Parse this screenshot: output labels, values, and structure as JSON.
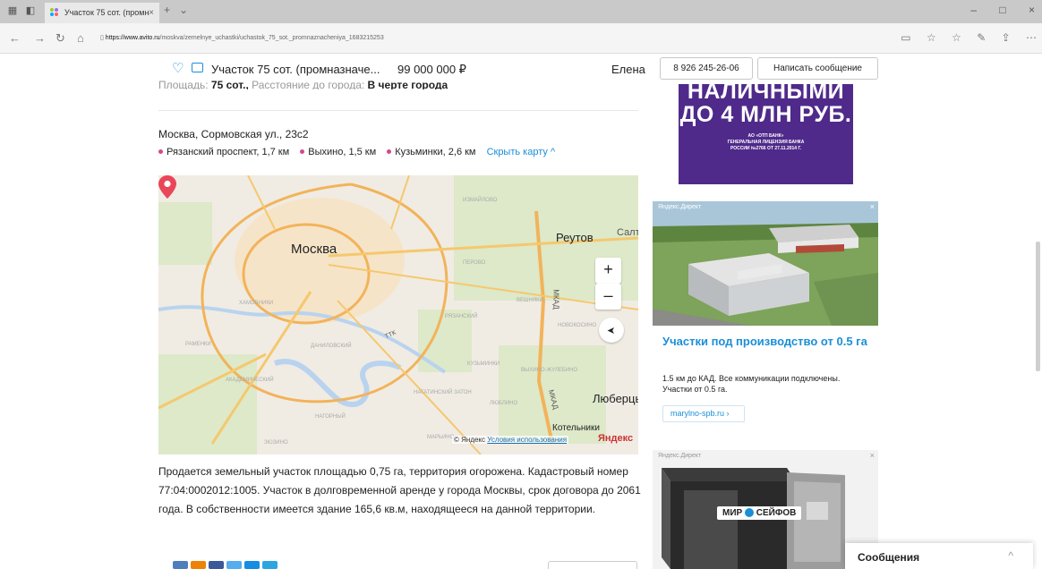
{
  "browser": {
    "tab_title": "Участок 75 сот. (промн",
    "tab_close": "×",
    "new_tab": "+",
    "tab_dropdown": "⌄",
    "window_controls": [
      "–",
      "□",
      "×"
    ],
    "url_host": "https://www.avito.ru",
    "url_path": "/moskva/zemelnye_uchastki/uchastok_75_sot._promnaznacheniya_1683215253"
  },
  "sticky": {
    "title": "Участок 75 сот. (промназначе...",
    "price": "99 000 000 ₽",
    "seller": "Елена",
    "phone": "8 926 245-26-06",
    "message_button": "Написать сообщение"
  },
  "details": {
    "area_label": "Площадь:",
    "area_value": "75 сот.,",
    "distance_label": "Расстояние до города:",
    "distance_value": "В черте города"
  },
  "location": {
    "address": "Москва, Сормовская ул., 23с2",
    "metro": [
      {
        "name": "Рязанский проспект, 1,7 км",
        "color": "#d44a88"
      },
      {
        "name": "Выхино, 1,5 км",
        "color": "#d44a88"
      },
      {
        "name": "Кузьминки, 2,6 км",
        "color": "#d44a88"
      }
    ],
    "hide_map": "Скрыть карту",
    "hide_map_arrow": "^"
  },
  "map": {
    "city_label": "Москва",
    "reutov_label": "Реутов",
    "lyubertsy_label": "Люберцы",
    "kotelniki_label": "Котельники",
    "salt_label": "Салт",
    "mkad_label": "МКАД",
    "ttk_label": "ТТК",
    "zoom_in": "+",
    "zoom_out": "–",
    "geolocate": "➤",
    "copyright": "© Яндекс",
    "terms_link": "Условия использования",
    "yandex_logo": "Яндекс",
    "small_labels": [
      "ИЗМАЙЛОВО",
      "ПЕРОВО",
      "ВЕШНЯКИ",
      "НОВОКОСИНО",
      "КУЗЬМИНКИ",
      "ВЫХИНО-ЖУЛЕБИНО",
      "ЛЮБЛИНО",
      "НАГАТИНСКИЙ ЗАТОН",
      "ДАНИЛОВСКИЙ",
      "ХАМОВНИКИ",
      "РЯЗАНСКИЙ",
      "НАГОРНЫЙ",
      "ЗЮЗИНО",
      "АКАДЕМИЧЕСКИЙ",
      "РАМЕНКИ",
      "МАРЬИНО"
    ]
  },
  "description": "Продается земельный участок площадью 0,75 га, территория огорожена. Кадастровый номер 77:04:0002012:1005. Участок в долговременной аренде у города Москвы, срок договора до 2061 года. В собственности имеется здание 165,6 кв.м, находящееся на данной территории.",
  "ads": {
    "bank": {
      "line1": "НАЛИЧНЫМИ",
      "line2": "ДО 4 МЛН РУБ.",
      "fine1": "АО «ОТП БАНК»",
      "fine2": "ГЕНЕРАЛЬНАЯ ЛИЦЕНЗИЯ БАНКА",
      "fine3": "РОССИИ №2766 ОТ 27.11.2014 Г."
    },
    "direct": {
      "tag": "Яндекс.Директ",
      "close": "×",
      "headline": "Участки под производство от 0.5 га",
      "text": "1.5 км до КАД. Все коммуникации подключены. Участки от 0.5 га.",
      "site": "marylno-spb.ru",
      "site_arrow": "›"
    },
    "safes": {
      "tag": "Яндекс.Директ",
      "close": "×",
      "brand_left": "МИР",
      "brand_right": "СЕЙФОВ"
    }
  },
  "messages": {
    "label": "Сообщения",
    "toggle": "^"
  }
}
